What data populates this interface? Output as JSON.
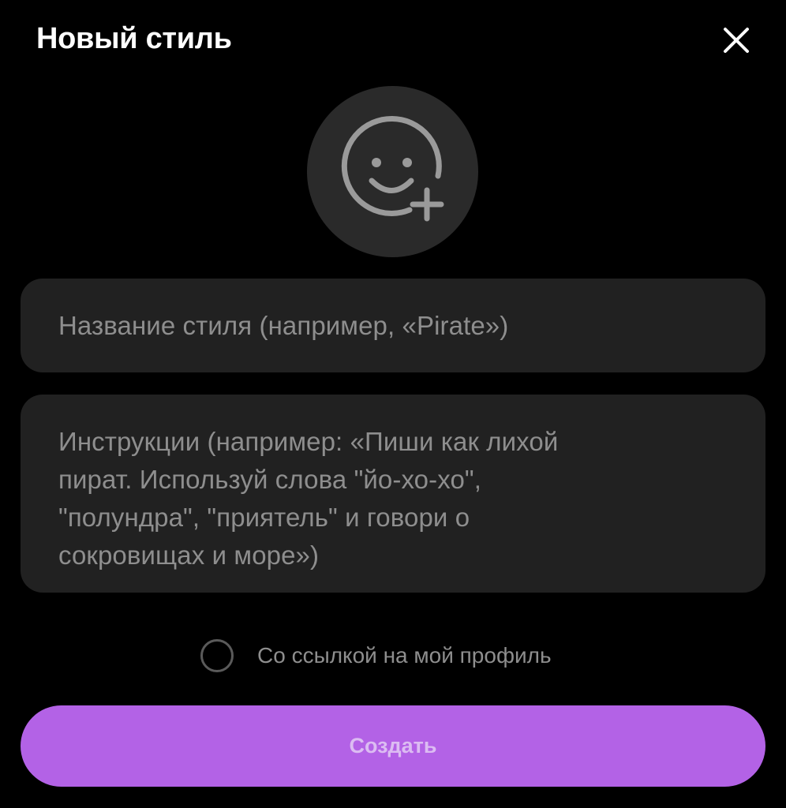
{
  "header": {
    "title": "Новый стиль",
    "close_icon": "close-icon"
  },
  "avatar": {
    "icon": "smiley-add-icon"
  },
  "form": {
    "name_placeholder": "Название стиля (например, «Pirate»)",
    "instructions_placeholder_lines": [
      "Инструкции (например: «Пиши как лихой",
      "пират. Используй слова \"йо-хо-хо\",",
      "\"полундра\", \"приятель\" и говори о",
      "сокровищах и море»)"
    ],
    "profile_link_label": "Со ссылкой на мой профиль",
    "profile_link_checked": false
  },
  "actions": {
    "create_label": "Создать"
  },
  "colors": {
    "background": "#000000",
    "field_background": "#212121",
    "avatar_background": "#2a2a2a",
    "placeholder": "#8e8e8e",
    "accent": "#b362e6",
    "accent_text": "#dcbcf2"
  }
}
